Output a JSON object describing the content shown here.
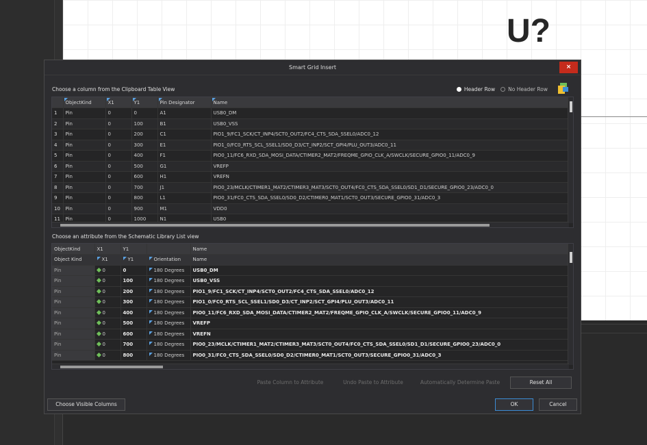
{
  "canvas": {
    "designator": "U?"
  },
  "dialog": {
    "title": "Smart Grid Insert",
    "close_label": "×",
    "clipboard_section_label": "Choose a column from the Clipboard Table View",
    "header_row_label": "Header Row",
    "no_header_row_label": "No Header Row",
    "header_row_selected": true,
    "attribute_section_label": "Choose an attribute from the Schematic Library List view",
    "buttons": {
      "paste_column": "Paste Column to Attribute",
      "undo_paste": "Undo Paste to Attribute",
      "auto_determine": "Automatically Determine Paste",
      "reset_all": "Reset All",
      "choose_columns": "Choose Visible Columns",
      "ok": "OK",
      "cancel": "Cancel"
    }
  },
  "clipboard_table": {
    "columns": [
      "ObjectKind",
      "X1",
      "Y1",
      "Pin Designator",
      "Name"
    ],
    "rows": [
      {
        "num": "1",
        "kind": "Pin",
        "x1": "0",
        "y1": "0",
        "des": "A1",
        "name": "USB0_DM"
      },
      {
        "num": "2",
        "kind": "Pin",
        "x1": "0",
        "y1": "100",
        "des": "B1",
        "name": "USB0_VSS"
      },
      {
        "num": "3",
        "kind": "Pin",
        "x1": "0",
        "y1": "200",
        "des": "C1",
        "name": "PIO1_9/FC1_SCK/CT_INP4/SCT0_OUT2/FC4_CTS_SDA_SSEL0/ADC0_12"
      },
      {
        "num": "4",
        "kind": "Pin",
        "x1": "0",
        "y1": "300",
        "des": "E1",
        "name": "PIO1_0/FC0_RTS_SCL_SSEL1/SD0_D3/CT_INP2/SCT_GPI4/PLU_OUT3/ADC0_11"
      },
      {
        "num": "5",
        "kind": "Pin",
        "x1": "0",
        "y1": "400",
        "des": "F1",
        "name": "PIO0_11/FC6_RXD_SDA_MOSI_DATA/CTIMER2_MAT2/FREQME_GPIO_CLK_A/SWCLK/SECURE_GPIO0_11/ADC0_9"
      },
      {
        "num": "6",
        "kind": "Pin",
        "x1": "0",
        "y1": "500",
        "des": "G1",
        "name": "VREFP"
      },
      {
        "num": "7",
        "kind": "Pin",
        "x1": "0",
        "y1": "600",
        "des": "H1",
        "name": "VREFN"
      },
      {
        "num": "8",
        "kind": "Pin",
        "x1": "0",
        "y1": "700",
        "des": "J1",
        "name": "PIO0_23/MCLK/CTIMER1_MAT2/CTIMER3_MAT3/SCT0_OUT4/FC0_CTS_SDA_SSEL0/SD1_D1/SECURE_GPIO0_23/ADC0_0"
      },
      {
        "num": "9",
        "kind": "Pin",
        "x1": "0",
        "y1": "800",
        "des": "L1",
        "name": "PIO0_31/FC0_CTS_SDA_SSEL0/SD0_D2/CTIMER0_MAT1/SCT0_OUT3/SECURE_GPIO0_31/ADC0_3"
      },
      {
        "num": "10",
        "kind": "Pin",
        "x1": "0",
        "y1": "900",
        "des": "M1",
        "name": "VDD0"
      },
      {
        "num": "11",
        "kind": "Pin",
        "x1": "0",
        "y1": "1000",
        "des": "N1",
        "name": "USB0"
      }
    ]
  },
  "attribute_table": {
    "group_headers": [
      "ObjectKind",
      "X1",
      "Y1",
      "",
      "Name"
    ],
    "columns": [
      "Object Kind",
      "X1",
      "Y1",
      "Orientation",
      "Name"
    ],
    "rows": [
      {
        "kind": "Pin",
        "x1": "0",
        "y1": "0",
        "orient": "180 Degrees",
        "name": "USB0_DM"
      },
      {
        "kind": "Pin",
        "x1": "0",
        "y1": "100",
        "orient": "180 Degrees",
        "name": "USB0_VSS"
      },
      {
        "kind": "Pin",
        "x1": "0",
        "y1": "200",
        "orient": "180 Degrees",
        "name": "PIO1_9/FC1_SCK/CT_INP4/SCT0_OUT2/FC4_CTS_SDA_SSEL0/ADC0_12"
      },
      {
        "kind": "Pin",
        "x1": "0",
        "y1": "300",
        "orient": "180 Degrees",
        "name": "PIO1_0/FC0_RTS_SCL_SSEL1/SD0_D3/CT_INP2/SCT_GPI4/PLU_OUT3/ADC0_11"
      },
      {
        "kind": "Pin",
        "x1": "0",
        "y1": "400",
        "orient": "180 Degrees",
        "name": "PIO0_11/FC6_RXD_SDA_MOSI_DATA/CTIMER2_MAT2/FREQME_GPIO_CLK_A/SWCLK/SECURE_GPIO0_11/ADC0_9"
      },
      {
        "kind": "Pin",
        "x1": "0",
        "y1": "500",
        "orient": "180 Degrees",
        "name": "VREFP"
      },
      {
        "kind": "Pin",
        "x1": "0",
        "y1": "600",
        "orient": "180 Degrees",
        "name": "VREFN"
      },
      {
        "kind": "Pin",
        "x1": "0",
        "y1": "700",
        "orient": "180 Degrees",
        "name": "PIO0_23/MCLK/CTIMER1_MAT2/CTIMER3_MAT3/SCT0_OUT4/FC0_CTS_SDA_SSEL0/SD1_D1/SECURE_GPIO0_23/ADC0_0"
      },
      {
        "kind": "Pin",
        "x1": "0",
        "y1": "800",
        "orient": "180 Degrees",
        "name": "PIO0_31/FC0_CTS_SDA_SSEL0/SD0_D2/CTIMER0_MAT1/SCT0_OUT3/SECURE_GPIO0_31/ADC0_3"
      }
    ]
  },
  "colors": {
    "accent": "#3c8dd6",
    "close": "#c42b1c",
    "flag": "#5aa0e0",
    "check": "#6fbf5a"
  }
}
